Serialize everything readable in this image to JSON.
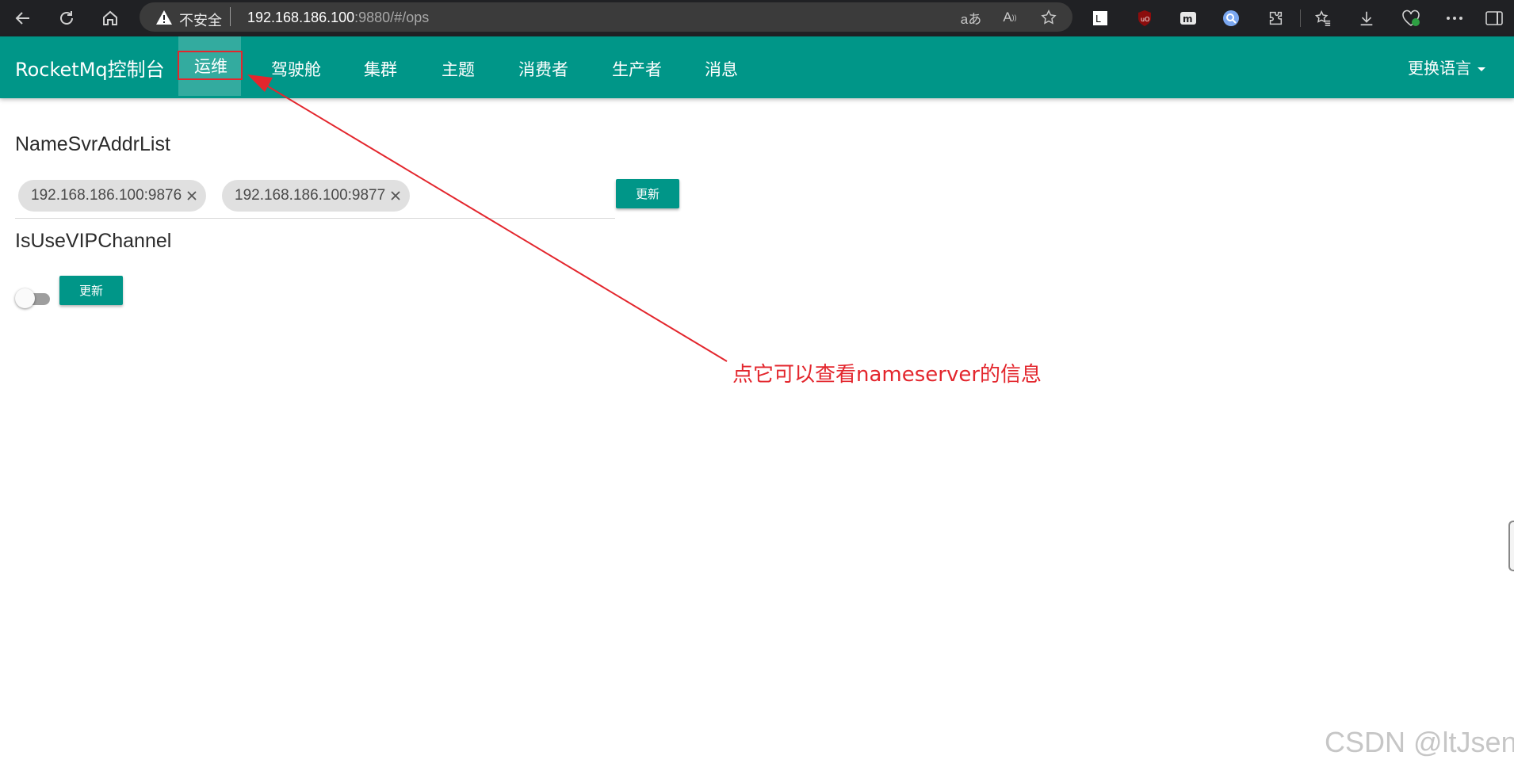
{
  "browser": {
    "security_label": "不安全",
    "url_host": "192.168.186.100",
    "url_rest": ":9880/#/ops",
    "toolbar_icons": [
      "back-icon",
      "refresh-icon",
      "home-icon",
      "read-aloud-icon",
      "immersive-reader-icon",
      "favorite-star-icon"
    ],
    "extension_icons": [
      "extension-lt-icon",
      "ublock-icon",
      "extension-m-icon",
      "search-extension-icon",
      "extensions-puzzle-icon",
      "favorites-icon",
      "downloads-icon",
      "browser-essentials-icon",
      "more-icon",
      "sidebar-icon"
    ]
  },
  "navbar": {
    "brand": "RocketMq控制台",
    "items": [
      {
        "label": "运维",
        "active": true
      },
      {
        "label": "驾驶舱"
      },
      {
        "label": "集群"
      },
      {
        "label": "主题"
      },
      {
        "label": "消费者"
      },
      {
        "label": "生产者"
      },
      {
        "label": "消息"
      }
    ],
    "language_label": "更换语言"
  },
  "ops": {
    "namesrv_title": "NameSvrAddrList",
    "namesrv_chips": [
      "192.168.186.100:9876",
      "192.168.186.100:9877"
    ],
    "update_label": "更新",
    "vip_title": "IsUseVIPChannel",
    "vip_enabled": false,
    "vip_update_label": "更新"
  },
  "annotation": {
    "text": "点它可以查看nameserver的信息",
    "color": "#e3262d"
  },
  "watermark": "CSDN @ltJsen",
  "colors": {
    "primary": "#009688",
    "chrome": "#202124",
    "chip": "#e0e0e0"
  }
}
